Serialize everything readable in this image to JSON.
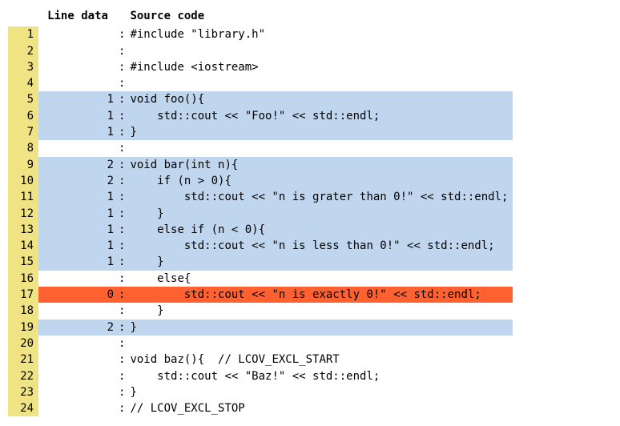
{
  "headers": {
    "line_data": "Line data",
    "source_code": "Source code"
  },
  "rows": [
    {
      "n": 1,
      "cov": "none",
      "hits": "",
      "src": "#include \"library.h\""
    },
    {
      "n": 2,
      "cov": "none",
      "hits": "",
      "src": ""
    },
    {
      "n": 3,
      "cov": "none",
      "hits": "",
      "src": "#include <iostream>"
    },
    {
      "n": 4,
      "cov": "none",
      "hits": "",
      "src": ""
    },
    {
      "n": 5,
      "cov": "covered",
      "hits": "1",
      "src": "void foo(){"
    },
    {
      "n": 6,
      "cov": "covered",
      "hits": "1",
      "src": "    std::cout << \"Foo!\" << std::endl;"
    },
    {
      "n": 7,
      "cov": "covered",
      "hits": "1",
      "src": "}"
    },
    {
      "n": 8,
      "cov": "none",
      "hits": "",
      "src": ""
    },
    {
      "n": 9,
      "cov": "covered",
      "hits": "2",
      "src": "void bar(int n){"
    },
    {
      "n": 10,
      "cov": "covered",
      "hits": "2",
      "src": "    if (n > 0){"
    },
    {
      "n": 11,
      "cov": "covered",
      "hits": "1",
      "src": "        std::cout << \"n is grater than 0!\" << std::endl;"
    },
    {
      "n": 12,
      "cov": "covered",
      "hits": "1",
      "src": "    }"
    },
    {
      "n": 13,
      "cov": "covered",
      "hits": "1",
      "src": "    else if (n < 0){"
    },
    {
      "n": 14,
      "cov": "covered",
      "hits": "1",
      "src": "        std::cout << \"n is less than 0!\" << std::endl;"
    },
    {
      "n": 15,
      "cov": "covered",
      "hits": "1",
      "src": "    }"
    },
    {
      "n": 16,
      "cov": "none",
      "hits": "",
      "src": "    else{"
    },
    {
      "n": 17,
      "cov": "uncovered",
      "hits": "0",
      "src": "        std::cout << \"n is exactly 0!\" << std::endl;"
    },
    {
      "n": 18,
      "cov": "none",
      "hits": "",
      "src": "    }"
    },
    {
      "n": 19,
      "cov": "covered",
      "hits": "2",
      "src": "}"
    },
    {
      "n": 20,
      "cov": "none",
      "hits": "",
      "src": ""
    },
    {
      "n": 21,
      "cov": "none",
      "hits": "",
      "src": "void baz(){  // LCOV_EXCL_START"
    },
    {
      "n": 22,
      "cov": "none",
      "hits": "",
      "src": "    std::cout << \"Baz!\" << std::endl;"
    },
    {
      "n": 23,
      "cov": "none",
      "hits": "",
      "src": "}"
    },
    {
      "n": 24,
      "cov": "none",
      "hits": "",
      "src": "// LCOV_EXCL_STOP"
    }
  ]
}
